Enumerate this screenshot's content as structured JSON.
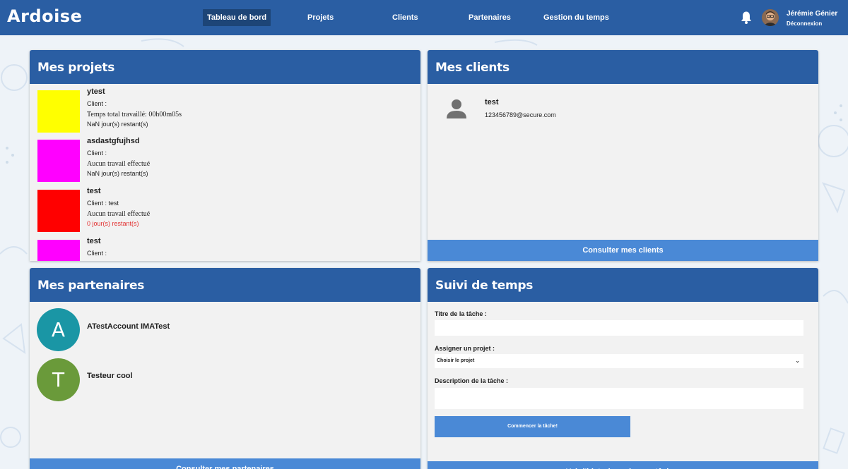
{
  "app": {
    "logo": "Ardoise"
  },
  "nav": {
    "items": [
      {
        "label": "Tableau de bord",
        "active": true
      },
      {
        "label": "Projets",
        "active": false
      },
      {
        "label": "Clients",
        "active": false
      },
      {
        "label": "Partenaires",
        "active": false
      },
      {
        "label": "Gestion du temps",
        "active": false
      }
    ]
  },
  "user": {
    "name": "Jérémie Génier",
    "logout_label": "Déconnexion"
  },
  "projects_panel": {
    "title": "Mes projets",
    "projects": [
      {
        "name": "ytest",
        "client": "Client :",
        "work": "Temps total travaillé: 00h00m05s",
        "remaining": "NaN jour(s) restant(s)",
        "color": "#ffff00",
        "late": false
      },
      {
        "name": "asdastgfujhsd",
        "client": "Client :",
        "work": "Aucun travail effectué",
        "remaining": "NaN jour(s) restant(s)",
        "color": "#ff00ff",
        "late": false
      },
      {
        "name": "test",
        "client": "Client : test",
        "work": "Aucun travail effectué",
        "remaining": "0 jour(s) restant(s)",
        "color": "#ff0000",
        "late": true
      },
      {
        "name": "test",
        "client": "Client :",
        "work": "",
        "remaining": "",
        "color": "#ff00ff",
        "late": false
      }
    ]
  },
  "clients_panel": {
    "title": "Mes clients",
    "clients": [
      {
        "name": "test",
        "email": "123456789@secure.com",
        "icon": "user-icon"
      }
    ],
    "button_label": "Consulter mes clients"
  },
  "partners_panel": {
    "title": "Mes partenaires",
    "partners": [
      {
        "initial": "A",
        "name": "ATestAccount IMATest",
        "color": "#1a96a5"
      },
      {
        "initial": "T",
        "name": "Testeur cool",
        "color": "#6a9a3a"
      }
    ],
    "button_label": "Consulter mes partenaires"
  },
  "time_panel": {
    "title": "Suivi de temps",
    "task_title_label": "Titre de la tâche :",
    "task_title_value": "",
    "project_label": "Assigner un projet :",
    "project_selected": "Choisir le projet",
    "description_label": "Description de la tâche :",
    "description_value": "",
    "start_button": "Commencer la tâche!",
    "bottom_button": "Voir l'historique de mes tâches"
  },
  "colors": {
    "primary": "#2a5ea3",
    "accent": "#4a89d6",
    "panel_bg": "#f2f2f2",
    "danger": "#e23030"
  }
}
